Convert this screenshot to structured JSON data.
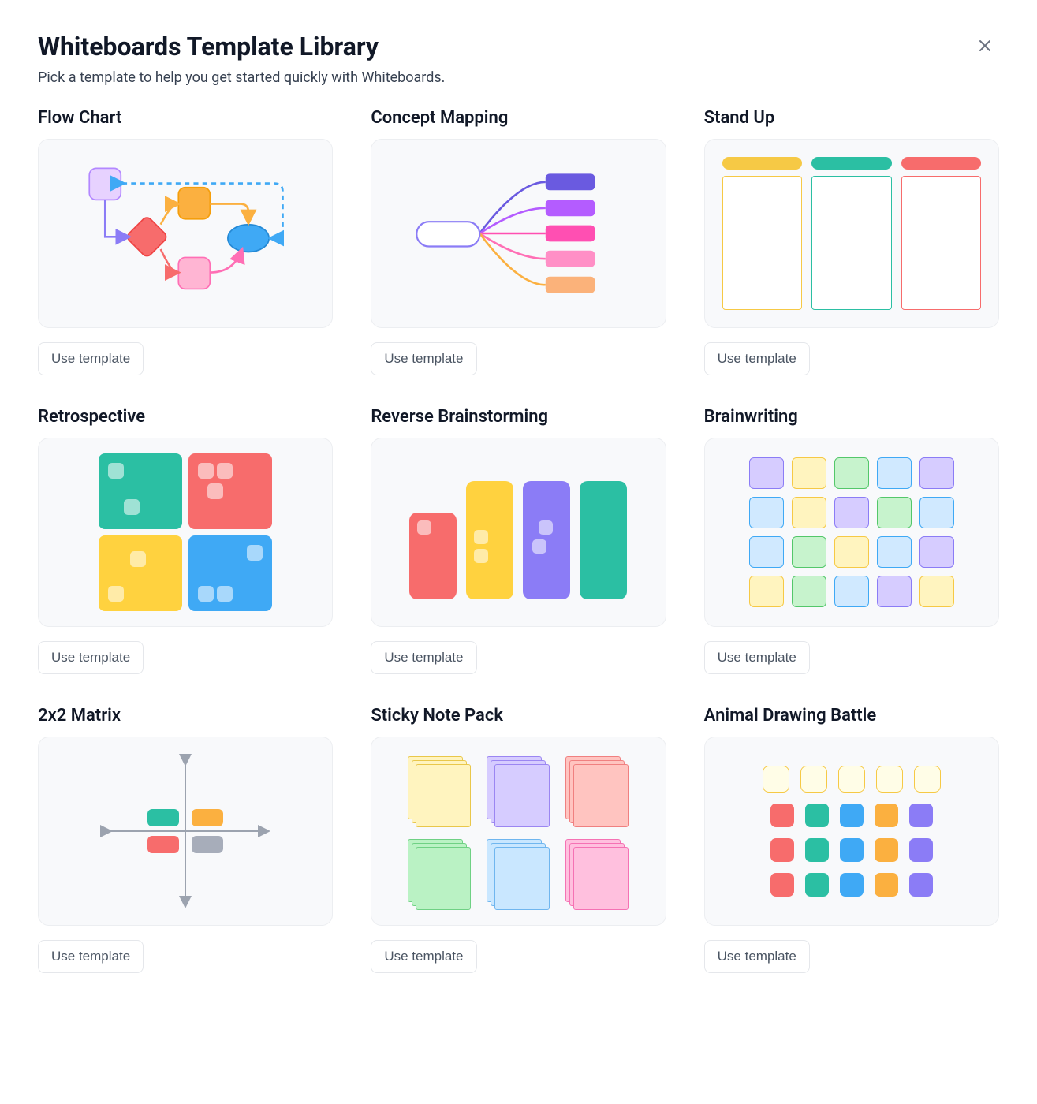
{
  "header": {
    "title": "Whiteboards Template Library",
    "subtitle": "Pick a template to help you get started quickly with Whiteboards."
  },
  "button_label": "Use template",
  "templates": [
    {
      "title": "Flow Chart"
    },
    {
      "title": "Concept Mapping"
    },
    {
      "title": "Stand Up"
    },
    {
      "title": "Retrospective"
    },
    {
      "title": "Reverse Brainstorming"
    },
    {
      "title": "Brainwriting"
    },
    {
      "title": "2x2 Matrix"
    },
    {
      "title": "Sticky Note Pack"
    },
    {
      "title": "Animal Drawing Battle"
    }
  ],
  "colors": {
    "teal": "#2bbfa3",
    "red": "#f76c6c",
    "yellow": "#ffd23f",
    "blue": "#3fa9f5",
    "purple": "#8b7cf6",
    "orange": "#fbb040",
    "pink": "#ff6fb5",
    "violet": "#b388ff",
    "green": "#7fe08b",
    "gray": "#a7adba",
    "indigo": "#6a5ae0",
    "lilac": "#e7d2ff",
    "cream": "#fff4bf"
  }
}
